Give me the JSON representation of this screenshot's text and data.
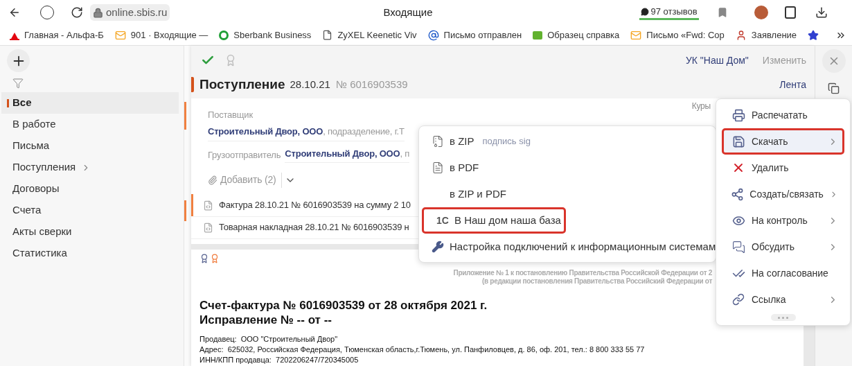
{
  "browser": {
    "address": "online.sbis.ru",
    "title": "Входящие",
    "reviews": "97 отзывов",
    "bookmarks": [
      {
        "label": "Главная - Альфа-Б",
        "kind": "alfa"
      },
      {
        "label": "901 · Входящие —",
        "kind": "mail"
      },
      {
        "label": "Sberbank Business",
        "kind": "sber"
      },
      {
        "label": "ZyXEL Keenetic Viv",
        "kind": "page"
      },
      {
        "label": "Письмо отправлен",
        "kind": "at"
      },
      {
        "label": "Образец справка",
        "kind": "rub"
      },
      {
        "label": "Письмо «Fwd: Cop",
        "kind": "mail"
      },
      {
        "label": "Заявление",
        "kind": "person"
      }
    ]
  },
  "sidebar": {
    "items": [
      {
        "label": "Все",
        "selected": true,
        "has_submenu": false
      },
      {
        "label": "В работе",
        "selected": false,
        "has_submenu": false
      },
      {
        "label": "Письма",
        "selected": false,
        "has_submenu": false
      },
      {
        "label": "Поступления",
        "selected": false,
        "has_submenu": true
      },
      {
        "label": "Договоры",
        "selected": false,
        "has_submenu": false
      },
      {
        "label": "Счета",
        "selected": false,
        "has_submenu": false
      },
      {
        "label": "Акты сверки",
        "selected": false,
        "has_submenu": false
      },
      {
        "label": "Статистика",
        "selected": false,
        "has_submenu": false
      }
    ]
  },
  "document": {
    "organization": "УК \"Наш Дом\"",
    "change": "Изменить",
    "title": "Поступление",
    "date": "28.10.21",
    "number": "№ 6016903539",
    "feed": "Лента",
    "courier": "Куры",
    "supplier": {
      "label": "Поставщик",
      "name": "Строительный Двор, ООО",
      "detail": ", подразделение, г.Т"
    },
    "shipper": {
      "label": "Грузоотправитель",
      "name": "Строительный Двор, ООО",
      "detail": ", п"
    },
    "attach": "Добавить (2)",
    "files": [
      {
        "label": "Фактура 28.10.21 № 6016903539 на сумму 2 10",
        "selected": true
      },
      {
        "label": "Товарная накладная 28.10.21 № 6016903539 н",
        "selected": false
      }
    ],
    "preview": {
      "appendix": [
        "Приложение № 1 к постановлению Правительства Российской Федерации от 2",
        "(в редакции постановления Правительства Российский Федерации от"
      ],
      "heading": [
        "Счет-фактура № 6016903539 от 28 октября 2021 г.",
        "Исправление № -- от --"
      ],
      "lines": [
        "Продавец:  ООО \"Строительный Двор\"",
        "Адрес:  625032, Российская Федерация, Тюменская область,г.Тюмень, ул. Панфиловцев, д. 86, оф. 201, тел.: 8 800 333 55 77",
        "ИНН/КПП продавца:  7202206247/720345005"
      ]
    }
  },
  "download_menu": {
    "items": [
      {
        "label": "в ZIP",
        "note": "подпись sig",
        "kind": "zip",
        "highlighted": false
      },
      {
        "label": "в PDF",
        "kind": "pdf",
        "highlighted": false
      },
      {
        "label": "в ZIP и PDF",
        "kind": "none",
        "highlighted": false
      },
      {
        "label": "В Наш дом наша база",
        "kind": "onec",
        "icon_text": "1С",
        "highlighted": true
      },
      {
        "label": "Настройка подключений к информационным системам",
        "kind": "wrench",
        "highlighted": false
      }
    ]
  },
  "actions_menu": {
    "items": [
      {
        "label": "Распечатать",
        "kind": "print",
        "has_submenu": false,
        "selected": false,
        "highlighted": false
      },
      {
        "label": "Скачать",
        "kind": "save",
        "has_submenu": true,
        "selected": true,
        "highlighted": true
      },
      {
        "label": "Удалить",
        "kind": "delete",
        "has_submenu": false,
        "selected": false,
        "highlighted": false
      },
      {
        "label": "Создать/связать",
        "kind": "share",
        "has_submenu": true,
        "selected": false,
        "highlighted": false
      },
      {
        "label": "На контроль",
        "kind": "eye",
        "has_submenu": true,
        "selected": false,
        "highlighted": false
      },
      {
        "label": "Обсудить",
        "kind": "chat",
        "has_submenu": true,
        "selected": false,
        "highlighted": false
      },
      {
        "label": "На согласование",
        "kind": "approve",
        "has_submenu": false,
        "selected": false,
        "highlighted": false
      },
      {
        "label": "Ссылка",
        "kind": "link",
        "has_submenu": true,
        "selected": false,
        "highlighted": false
      }
    ]
  }
}
